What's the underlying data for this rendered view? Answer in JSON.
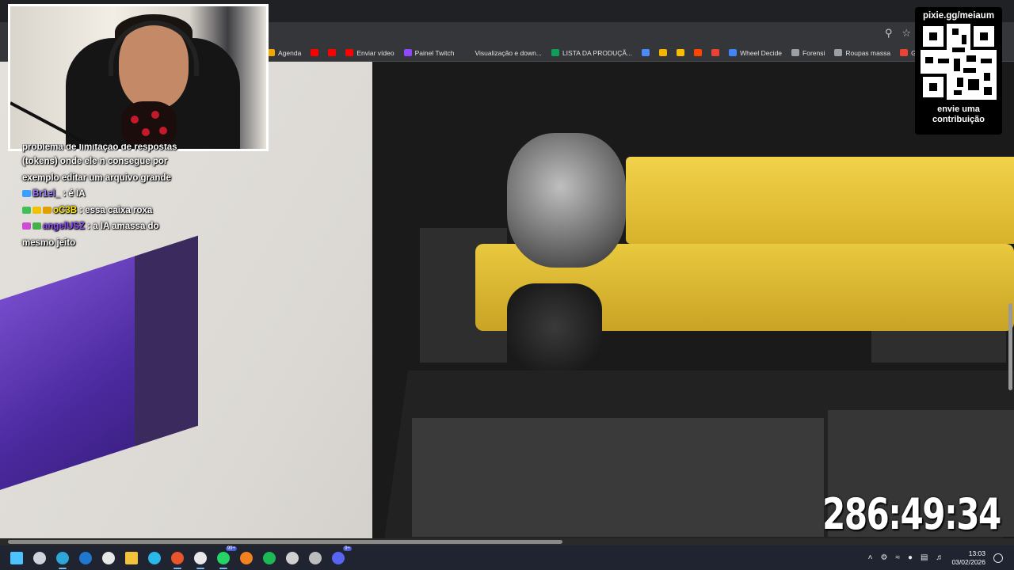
{
  "bookmarks": [
    {
      "label": "Agenda",
      "icon": "calendar-icon",
      "color": "#f2a600"
    },
    {
      "label": "",
      "icon": "youtube-icon",
      "color": "#ff0000"
    },
    {
      "label": "",
      "icon": "youtube-icon",
      "color": "#ff0000"
    },
    {
      "label": "Enviar vídeo",
      "icon": "youtube-icon",
      "color": "#ff0000"
    },
    {
      "label": "Painel Twitch",
      "icon": "twitch-icon",
      "color": "#9146ff"
    },
    {
      "label": "Visualização e down...",
      "icon": "page-icon",
      "color": "#35363a"
    },
    {
      "label": "LISTA DA PRODUÇÃ...",
      "icon": "sheets-icon",
      "color": "#0f9d58"
    },
    {
      "label": "",
      "icon": "app-icon",
      "color": "#4c8bf5"
    },
    {
      "label": "",
      "icon": "drive-icon",
      "color": "#f4b400"
    },
    {
      "label": "",
      "icon": "keep-icon",
      "color": "#fbbc04"
    },
    {
      "label": "",
      "icon": "reddit-icon",
      "color": "#ff4500"
    },
    {
      "label": "",
      "icon": "gmail-icon",
      "color": "#ea4335"
    },
    {
      "label": "Wheel Decide",
      "icon": "chrome-icon",
      "color": "#4285f4"
    },
    {
      "label": "Forensi",
      "icon": "globe-icon",
      "color": "#9aa0a6"
    },
    {
      "label": "Roupas massa",
      "icon": "folder-icon",
      "color": "#9aa0a6"
    },
    {
      "label": "Gmail",
      "icon": "gmail-icon",
      "color": "#ea4335"
    }
  ],
  "toolbar": {
    "zoom_icon": "zoom-icon",
    "star_icon": "star-icon"
  },
  "chat": {
    "messages": [
      {
        "user": "",
        "text": "problema de limitação de respostas",
        "badges": [],
        "user_color": "#ffffff"
      },
      {
        "user": "",
        "text": "(tokens) onde ele n consegue por",
        "badges": [],
        "user_color": "#ffffff"
      },
      {
        "user": "",
        "text": "exemplo editar um arquivo grande",
        "badges": [],
        "user_color": "#ffffff"
      },
      {
        "user": "Br1el_",
        "text": "é IA",
        "badges": [
          "#3aa0ff"
        ],
        "user_color": "#9b7bff"
      },
      {
        "user": "oC3B",
        "text": "essa caixa roxa",
        "badges": [
          "#3fbf5a",
          "#f2c200",
          "#e0a000"
        ],
        "user_color": "#ffe600"
      },
      {
        "user": "angelUSZ",
        "text": "a IA amassa do",
        "badges": [
          "#d04ad6",
          "#46b04a"
        ],
        "user_color": "#8d4cff"
      },
      {
        "user": "",
        "text": "mesmo jeito",
        "badges": [],
        "user_color": "#ffffff"
      }
    ]
  },
  "qr": {
    "url": "pixie.gg/meiaum",
    "caption_line1": "envie uma",
    "caption_line2": "contribuição"
  },
  "timer": {
    "value": "286:49:34"
  },
  "taskbar": {
    "icons": [
      {
        "name": "windows-start-icon",
        "color": "#4cc2ff"
      },
      {
        "name": "task-view-icon",
        "color": "#cfd4dc"
      },
      {
        "name": "edge-icon",
        "color": "#2fa6d8"
      },
      {
        "name": "outlook-icon",
        "color": "#1f77d0"
      },
      {
        "name": "store-icon",
        "color": "#e8e8e8"
      },
      {
        "name": "file-explorer-icon",
        "color": "#f3c33b"
      },
      {
        "name": "cortana-icon",
        "color": "#2ab8e8"
      },
      {
        "name": "streaming-app-icon",
        "color": "#e8542c"
      },
      {
        "name": "chrome-icon",
        "color": "#e8e8e8"
      },
      {
        "name": "whatsapp-icon",
        "color": "#25d366",
        "badge": "99+"
      },
      {
        "name": "cloud-icon",
        "color": "#f48120"
      },
      {
        "name": "spotify-icon",
        "color": "#1db954"
      },
      {
        "name": "bot-icon",
        "color": "#d0d0d0"
      },
      {
        "name": "obs-icon",
        "color": "#bdbdbd"
      },
      {
        "name": "discord-icon",
        "color": "#5865f2",
        "badge": "9+"
      }
    ],
    "time": "13:03",
    "date": "03/02/2026"
  }
}
